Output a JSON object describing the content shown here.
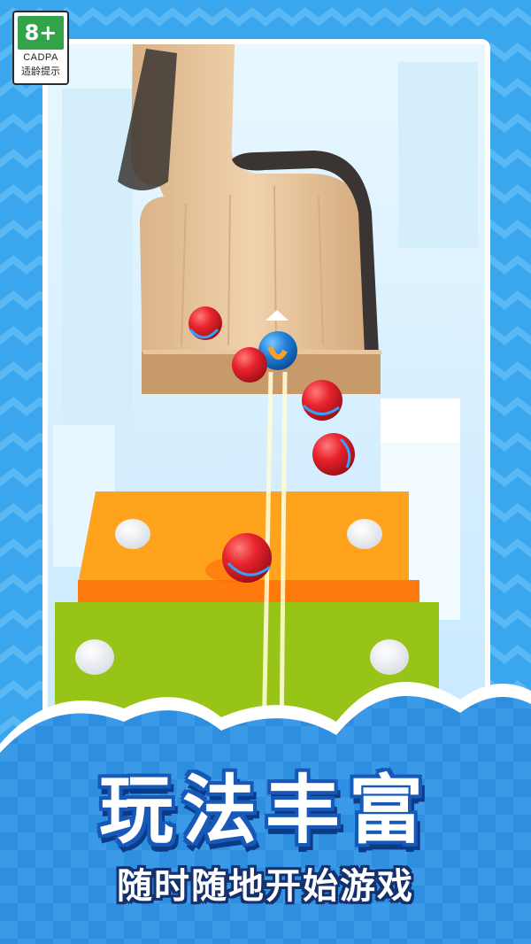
{
  "rating": {
    "age": "8+",
    "org": "CADPA",
    "tip": "适龄提示"
  },
  "headline": {
    "main": "玩法丰富",
    "sub": "随时随地开始游戏"
  },
  "colors": {
    "sky_blue": "#3aa6ee",
    "panel_sky": "#d9f1ff",
    "wood": "#e6c39a",
    "orange_block": "#ffa21c",
    "green_block": "#97c416",
    "ball_red": "#e8232c",
    "ball_blue": "#1f7fd6",
    "title_outline": "#1659b8"
  },
  "scene": {
    "balls": [
      "red-ball",
      "blue-ball",
      "red-ball",
      "red-ball",
      "red-ball",
      "red-ball"
    ],
    "holes": [
      "white-hole",
      "white-hole",
      "white-hole",
      "white-hole"
    ]
  }
}
